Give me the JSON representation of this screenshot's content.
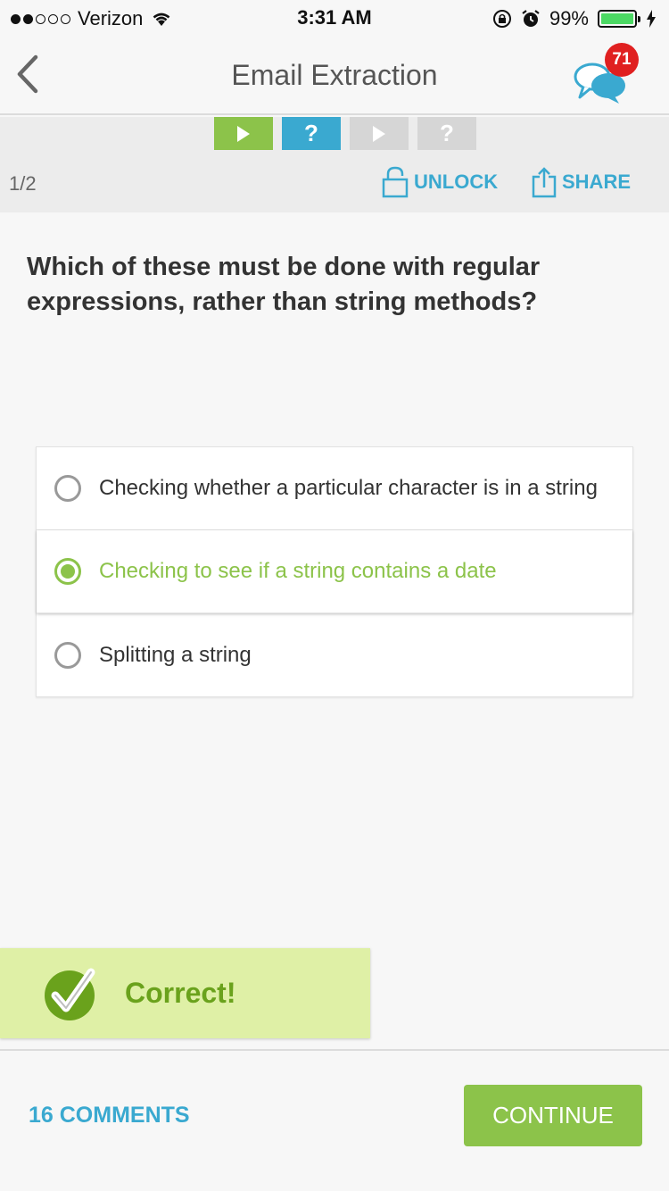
{
  "status_bar": {
    "carrier": "Verizon",
    "signal_bars_filled": 2,
    "signal_bars_total": 5,
    "time": "3:31 AM",
    "battery_percent": "99%"
  },
  "nav": {
    "title": "Email Extraction",
    "notification_count": "71"
  },
  "steps": [
    {
      "icon": "play-icon",
      "state": "complete"
    },
    {
      "icon": "question-icon",
      "label": "?",
      "state": "current"
    },
    {
      "icon": "play-icon",
      "state": "pending"
    },
    {
      "icon": "question-icon",
      "label": "?",
      "state": "pending"
    }
  ],
  "toolbar": {
    "page_count": "1/2",
    "unlock_label": "UNLOCK",
    "share_label": "SHARE"
  },
  "question": {
    "text": "Which of these must be done with regular expressions, rather than string methods?"
  },
  "options": [
    {
      "text": "Checking whether a particular character is in a string",
      "selected": false
    },
    {
      "text": "Checking to see if a string contains a date",
      "selected": true
    },
    {
      "text": "Splitting a string",
      "selected": false
    }
  ],
  "feedback": {
    "text": "Correct!"
  },
  "footer": {
    "comments_label": "16 COMMENTS",
    "continue_label": "CONTINUE"
  },
  "colors": {
    "accent_green": "#8cc34a",
    "accent_blue": "#3aa9d0",
    "feedback_bg": "#dff0a6",
    "badge_red": "#e02020"
  }
}
